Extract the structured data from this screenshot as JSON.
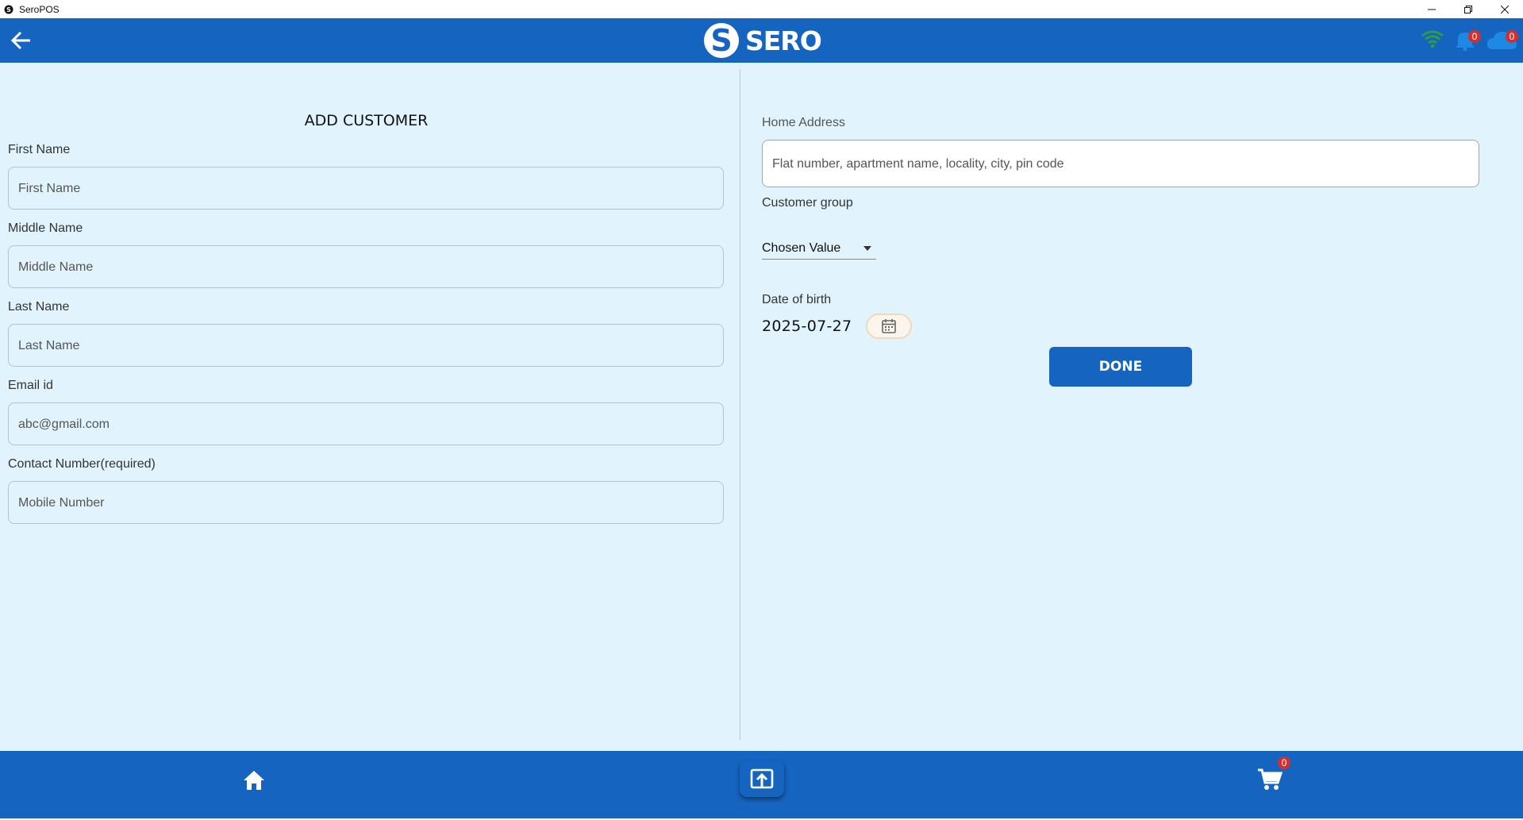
{
  "window": {
    "title": "SeroPOS",
    "controls": [
      "minimize",
      "restore",
      "close"
    ]
  },
  "header": {
    "logo_text": "SERO",
    "icons": [
      "back-arrow-icon",
      "wifi-icon",
      "bell-icon",
      "cloud-icon"
    ],
    "notification_count": "0",
    "sync_count": "0",
    "colors": {
      "bar": "#1565c0",
      "wifi": "#2e9e3e",
      "badge": "#d32f2f"
    }
  },
  "form": {
    "title": "ADD CUSTOMER",
    "first_name": {
      "label": "First Name",
      "placeholder": "First Name"
    },
    "middle_name": {
      "label": "Middle Name",
      "placeholder": "Middle Name"
    },
    "last_name": {
      "label": "Last Name",
      "placeholder": "Last Name"
    },
    "email": {
      "label": "Email id",
      "placeholder": "abc@gmail.com"
    },
    "contact": {
      "label": "Contact Number(required)",
      "placeholder": "Mobile Number"
    },
    "home_address": {
      "label": "Home Address",
      "placeholder": "Flat number, apartment name, locality, city, pin code"
    },
    "customer_group": {
      "label": "Customer group",
      "selected": "Chosen Value"
    },
    "dob": {
      "label": "Date of birth",
      "value": "2025-07-27"
    },
    "done_label": "DONE"
  },
  "bottom_nav": {
    "icons": [
      "home-icon",
      "upload-icon",
      "cart-icon"
    ],
    "cart_count": "0"
  },
  "colors": {
    "background": "#e1f3fd",
    "primary": "#1565c0"
  }
}
